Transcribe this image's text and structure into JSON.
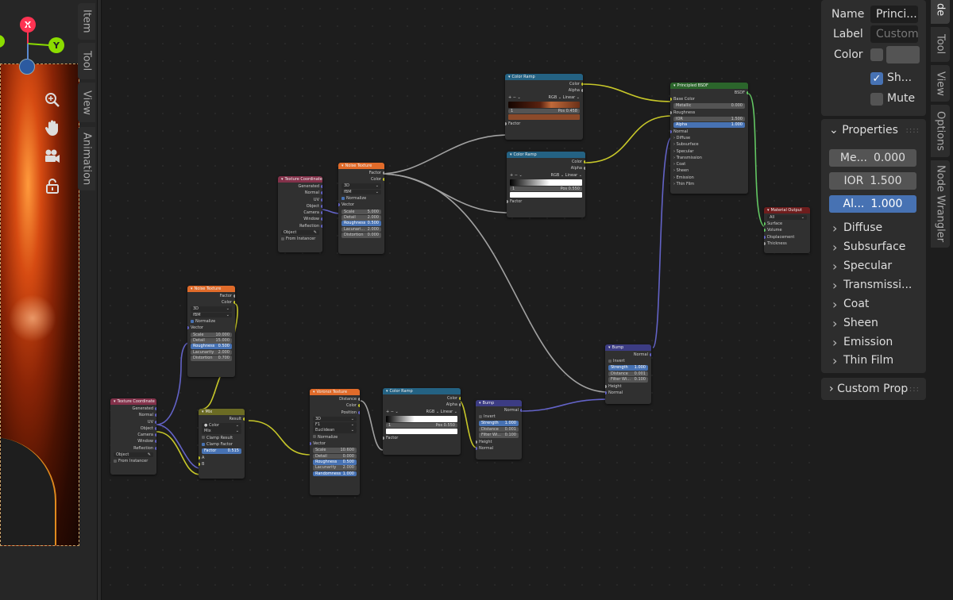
{
  "viewport": {
    "axis_x": "X",
    "axis_y": "Y",
    "tabs": [
      "Item",
      "Tool",
      "View",
      "Animation"
    ],
    "tools": [
      "zoom-icon",
      "hand-pan-icon",
      "camera-icon",
      "lock-icon"
    ]
  },
  "nodes": {
    "tex_coord_1": {
      "title": "Texture Coordinate",
      "outputs": [
        "Generated",
        "Normal",
        "UV",
        "Object",
        "Camera",
        "Window",
        "Reflection"
      ],
      "object_placeholder": "Object",
      "from_instancer": "From Instancer"
    },
    "noise_1": {
      "title": "Noise Texture",
      "outputs": [
        "Factor",
        "Color"
      ],
      "dim": "3D",
      "type": "fBM",
      "normalize": "Normalize",
      "vector": "Vector",
      "fields": [
        {
          "label": "Scale",
          "value": "5.000"
        },
        {
          "label": "Detail",
          "value": "2.000"
        },
        {
          "label": "Roughness",
          "value": "0.500"
        },
        {
          "label": "Lacunari...",
          "value": "2.000"
        },
        {
          "label": "Distortion",
          "value": "0.000"
        }
      ]
    },
    "ramp_1": {
      "title": "Color Ramp",
      "outputs": [
        "Color",
        "Alpha"
      ],
      "mode": "RGB",
      "interp": "Linear",
      "index": "1",
      "pos_label": "Pos",
      "pos": "0.458",
      "swatch": "#8b4a2a",
      "factor": "Factor"
    },
    "ramp_2": {
      "title": "Color Ramp",
      "outputs": [
        "Color",
        "Alpha"
      ],
      "mode": "RGB",
      "interp": "Linear",
      "index": "1",
      "pos_label": "Pos",
      "pos": "0.550",
      "swatch": "#ffffff",
      "factor": "Factor"
    },
    "bsdf": {
      "title": "Principled BSDF",
      "output": "BSDF",
      "base_color": "Base Color",
      "fields": [
        {
          "label": "Metallic",
          "value": "0.000"
        },
        {
          "label": "Roughness",
          "value": ""
        },
        {
          "label": "IOR",
          "value": "1.500"
        },
        {
          "label": "Alpha",
          "value": "1.000"
        }
      ],
      "normal": "Normal",
      "subpanels": [
        "Diffuse",
        "Subsurface",
        "Specular",
        "Transmission",
        "Coat",
        "Sheen",
        "Emission",
        "Thin Film"
      ]
    },
    "output": {
      "title": "Material Output",
      "target": "All",
      "inputs": [
        "Surface",
        "Volume",
        "Displacement",
        "Thickness"
      ]
    },
    "noise_2": {
      "title": "Noise Texture",
      "outputs": [
        "Factor",
        "Color"
      ],
      "dim": "3D",
      "type": "fBM",
      "normalize": "Normalize",
      "vector": "Vector",
      "fields": [
        {
          "label": "Scale",
          "value": "10.000"
        },
        {
          "label": "Detail",
          "value": "15.000"
        },
        {
          "label": "Roughness",
          "value": "0.500"
        },
        {
          "label": "Lacunarity",
          "value": "2.000"
        },
        {
          "label": "Distortion",
          "value": "0.700"
        }
      ]
    },
    "tex_coord_2": {
      "title": "Texture Coordinate",
      "outputs": [
        "Generated",
        "Normal",
        "UV",
        "Object",
        "Camera",
        "Window",
        "Reflection"
      ],
      "object_placeholder": "Object",
      "from_instancer": "From Instancer"
    },
    "mix": {
      "title": "Mix",
      "output": "Result",
      "data_type": "Color",
      "blend": "Mix",
      "clamp_result": "Clamp Result",
      "clamp_factor": "Clamp Factor",
      "factor_label": "Factor",
      "factor": "0.515",
      "a": "A",
      "b": "B"
    },
    "voronoi": {
      "title": "Voronoi Texture",
      "outputs": [
        "Distance",
        "Color",
        "Position"
      ],
      "dim": "3D",
      "feature": "F1",
      "metric": "Euclidean",
      "normalize": "Normalize",
      "vector": "Vector",
      "fields": [
        {
          "label": "Scale",
          "value": "10.600"
        },
        {
          "label": "Detail",
          "value": "0.000"
        },
        {
          "label": "Roughness",
          "value": "0.500"
        },
        {
          "label": "Lacunarity",
          "value": "2.000"
        },
        {
          "label": "Randomness",
          "value": "1.000"
        }
      ]
    },
    "ramp_3": {
      "title": "Color Ramp",
      "outputs": [
        "Color",
        "Alpha"
      ],
      "mode": "RGB",
      "interp": "Linear",
      "index": "1",
      "pos_label": "Pos",
      "pos": "0.550",
      "swatch": "#ffffff",
      "factor": "Factor"
    },
    "bump_1": {
      "title": "Bump",
      "output": "Normal",
      "invert": "Invert",
      "fields": [
        {
          "label": "Strength",
          "value": "1.000"
        },
        {
          "label": "Distance",
          "value": "0.001"
        },
        {
          "label": "Filter Wi...",
          "value": "0.100"
        }
      ],
      "height": "Height",
      "normal": "Normal"
    },
    "bump_2": {
      "title": "Bump",
      "output": "Normal",
      "invert": "Invert",
      "fields": [
        {
          "label": "Strength",
          "value": "1.000"
        },
        {
          "label": "Distance",
          "value": "0.001"
        },
        {
          "label": "Filter Wi...",
          "value": "0.100"
        }
      ],
      "height": "Height",
      "normal": "Normal"
    }
  },
  "right_panel": {
    "name_label": "Name",
    "name_value": "Princi...",
    "label_label": "Label",
    "label_placeholder": "Custom",
    "color_label": "Color",
    "show_label": "Sh...",
    "mute_label": "Mute",
    "properties_header": "Properties",
    "sliders": [
      {
        "label": "Me...",
        "value": "0.000"
      },
      {
        "label": "IOR",
        "value": "1.500"
      },
      {
        "label": "Al...",
        "value": "1.000"
      }
    ],
    "subpanels": [
      "Diffuse",
      "Subsurface",
      "Specular",
      "Transmissi...",
      "Coat",
      "Sheen",
      "Emission",
      "Thin Film"
    ],
    "custom_props": "Custom Prop",
    "tabs": [
      "de",
      "Tool",
      "View",
      "Options",
      "Node Wrangler"
    ]
  },
  "colors": {
    "wire_color": "#c7c729",
    "wire_float": "#a1a1a1",
    "wire_vector": "#6363c7",
    "wire_shader": "#63c763",
    "header_texcoord": "#83314a",
    "header_texture": "#e06b2a",
    "header_converter": "#246283",
    "header_shader": "#2b652b",
    "header_output": "#6e1d1d",
    "header_vector": "#3c3c83",
    "header_mix": "#6b6b24",
    "accent": "#4772b3"
  }
}
